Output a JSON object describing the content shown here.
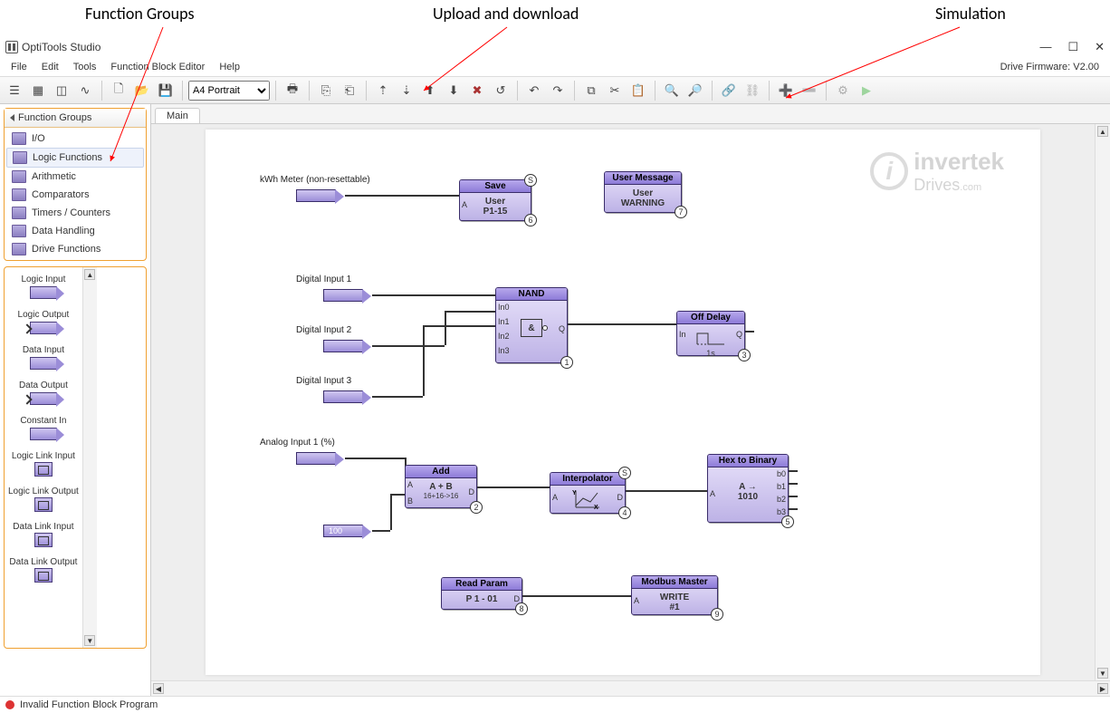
{
  "callouts": {
    "fg": "Function Groups",
    "ud": "Upload and download",
    "sim": "Simulation"
  },
  "app": {
    "title": "OptiTools Studio"
  },
  "window": {
    "min": "—",
    "max": "☐",
    "close": "✕"
  },
  "menu": {
    "file": "File",
    "edit": "Edit",
    "tools": "Tools",
    "fbe": "Function Block Editor",
    "help": "Help"
  },
  "firmware": "Drive Firmware: V2.00",
  "toolbar": {
    "paper": "A4 Portrait"
  },
  "sidebar": {
    "header": "Function Groups",
    "items": [
      {
        "label": "I/O"
      },
      {
        "label": "Logic Functions"
      },
      {
        "label": "Arithmetic"
      },
      {
        "label": "Comparators"
      },
      {
        "label": "Timers / Counters"
      },
      {
        "label": "Data Handling"
      },
      {
        "label": "Drive Functions"
      }
    ]
  },
  "palette": [
    "Logic Input",
    "Logic Output",
    "Data Input",
    "Data Output",
    "Constant In",
    "Logic Link Input",
    "Logic Link Output",
    "Data Link Input",
    "Data Link Output"
  ],
  "tab": {
    "main": "Main"
  },
  "labels": {
    "kwh": "kWh Meter (non-resettable)",
    "di1": "Digital Input 1",
    "di2": "Digital Input 2",
    "di3": "Digital Input 3",
    "ai1": "Analog Input 1 (%)",
    "c100": "100"
  },
  "blocks": {
    "save": {
      "title": "Save",
      "body1": "User",
      "body2": "P1-15",
      "a": "A",
      "s": "S",
      "n": "6"
    },
    "usermsg": {
      "title": "User Message",
      "body1": "User",
      "body2": "WARNING",
      "n": "7"
    },
    "nand": {
      "title": "NAND",
      "in0": "In0",
      "in1": "In1",
      "in2": "In2",
      "in3": "In3",
      "q": "Q",
      "sym": "&",
      "n": "1"
    },
    "offdly": {
      "title": "Off Delay",
      "in": "In",
      "q": "Q",
      "t": "1s",
      "n": "3"
    },
    "add": {
      "title": "Add",
      "body1": "A + B",
      "body2": "16+16->16",
      "a": "A",
      "b": "B",
      "d": "D",
      "n": "2"
    },
    "interp": {
      "title": "Interpolator",
      "a": "A",
      "d": "D",
      "s": "S",
      "n": "4"
    },
    "hex": {
      "title": "Hex to Binary",
      "body1": "A →",
      "body2": "1010",
      "a": "A",
      "b0": "b0",
      "b1": "b1",
      "b2": "b2",
      "b3": "b3",
      "n": "5"
    },
    "readp": {
      "title": "Read Param",
      "body": "P 1 - 01",
      "d": "D",
      "n": "8"
    },
    "modbus": {
      "title": "Modbus Master",
      "body1": "WRITE",
      "body2": "#1",
      "a": "A",
      "n": "9"
    }
  },
  "watermark": {
    "brand": "invertek",
    "sub": "Drives",
    "dom": ".com"
  },
  "status": {
    "text": "Invalid Function Block Program"
  }
}
